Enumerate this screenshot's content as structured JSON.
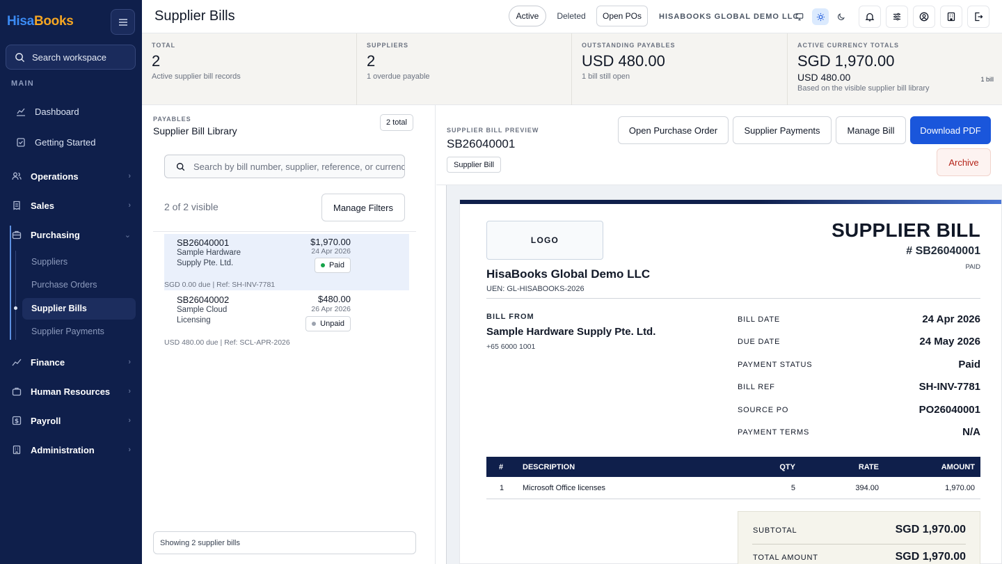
{
  "sidebar": {
    "brand_a": "Hisa",
    "brand_b": "Books",
    "search_label": "Search workspace",
    "section_label": "MAIN",
    "items": {
      "dashboard": "Dashboard",
      "getting_started": "Getting Started",
      "operations": "Operations",
      "sales": "Sales",
      "purchasing": "Purchasing",
      "finance": "Finance",
      "human_resources": "Human Resources",
      "payroll": "Payroll",
      "administration": "Administration"
    },
    "sub_items": {
      "suppliers": "Suppliers",
      "purchase_orders": "Purchase Orders",
      "supplier_bills": "Supplier Bills",
      "supplier_payments": "Supplier Payments"
    }
  },
  "topbar": {
    "title": "Supplier Bills",
    "filter_active": "Active",
    "filter_deleted": "Deleted",
    "open_pos": "Open POs",
    "org_name": "HISABOOKS GLOBAL DEMO LLC"
  },
  "stats": {
    "total": {
      "label": "TOTAL",
      "value": "2",
      "sub": "Active supplier bill records"
    },
    "suppliers": {
      "label": "SUPPLIERS",
      "value": "2",
      "sub": "1 overdue payable"
    },
    "outstanding": {
      "label": "OUTSTANDING PAYABLES",
      "value": "USD 480.00",
      "sub": "1 bill still open"
    },
    "currency": {
      "label": "ACTIVE CURRENCY TOTALS",
      "value": "SGD 1,970.00",
      "value2": "USD 480.00",
      "value2_count": "1 bill",
      "sub": "Based on the visible supplier bill library"
    }
  },
  "library": {
    "eyebrow": "PAYABLES",
    "title": "Supplier Bill Library",
    "total_badge": "2 total",
    "search_placeholder": "Search by bill number, supplier, reference, or currency",
    "visible_count": "2 of 2 visible",
    "filters_button": "Manage Filters",
    "bills": [
      {
        "number": "SB26040001",
        "supplier": "Sample Hardware Supply Pte. Ltd.",
        "amount": "$1,970.00",
        "date": "24 Apr 2026",
        "status": "Paid",
        "meta": "SGD 0.00 due | Ref: SH-INV-7781"
      },
      {
        "number": "SB26040002",
        "supplier": "Sample Cloud Licensing",
        "amount": "$480.00",
        "date": "26 Apr 2026",
        "status": "Unpaid",
        "meta": "USD 480.00 due | Ref: SCL-APR-2026"
      }
    ],
    "footer": "Showing 2 supplier bills"
  },
  "preview": {
    "eyebrow": "SUPPLIER BILL PREVIEW",
    "number": "SB26040001",
    "tag": "Supplier Bill",
    "btn_open_po": "Open Purchase Order",
    "btn_payments": "Supplier Payments",
    "btn_manage": "Manage Bill",
    "btn_download": "Download PDF",
    "btn_archive": "Archive"
  },
  "document": {
    "logo": "LOGO",
    "title": "SUPPLIER BILL",
    "number": "# SB26040001",
    "status": "PAID",
    "company": "HisaBooks Global Demo LLC",
    "uen": "UEN: GL-HISABOOKS-2026",
    "bill_from_label": "BILL FROM",
    "supplier": "Sample Hardware Supply Pte. Ltd.",
    "phone": "+65 6000 1001",
    "fields": [
      {
        "label": "BILL DATE",
        "value": "24 Apr 2026"
      },
      {
        "label": "DUE DATE",
        "value": "24 May 2026"
      },
      {
        "label": "PAYMENT STATUS",
        "value": "Paid"
      },
      {
        "label": "BILL REF",
        "value": "SH-INV-7781"
      },
      {
        "label": "SOURCE PO",
        "value": "PO26040001"
      },
      {
        "label": "PAYMENT TERMS",
        "value": "N/A"
      }
    ],
    "table_headers": {
      "num": "#",
      "desc": "DESCRIPTION",
      "qty": "QTY",
      "rate": "RATE",
      "amount": "AMOUNT"
    },
    "lines": [
      {
        "num": "1",
        "desc": "Microsoft Office licenses",
        "qty": "5",
        "rate": "394.00",
        "amount": "1,970.00"
      }
    ],
    "subtotal_label": "SUBTOTAL",
    "subtotal_value": "SGD 1,970.00",
    "total_label": "TOTAL AMOUNT",
    "total_value": "SGD 1,970.00"
  },
  "colors": {
    "sidebar": "#0f1f4b",
    "accent": "#1a56db",
    "paid": "#16a34a",
    "unpaid": "#9ca3af"
  }
}
